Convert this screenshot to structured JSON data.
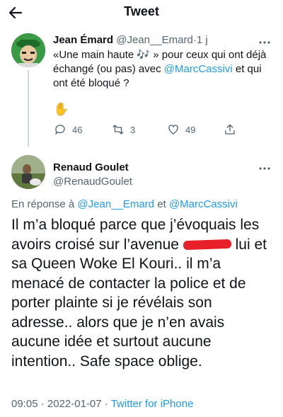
{
  "header": {
    "title": "Tweet"
  },
  "parent_tweet": {
    "display_name": "Jean Émard",
    "handle": "@Jean__Emard",
    "sep": "·",
    "time": "1 j",
    "text_1": "«Une main haute ",
    "emoji_notes": "🎶",
    "text_2": " » pour ceux qui ont déjà échangé (ou pas) avec ",
    "mention": "@MarcCassivi",
    "text_3": " et qui ont été bloqué ?",
    "emoji_hand": "✋",
    "replies": "46",
    "retweets": "3",
    "likes": "49"
  },
  "reply_tweet": {
    "display_name": "Renaud Goulet",
    "handle": "@RenaudGoulet",
    "reply_prefix": "En réponse à ",
    "reply_to_1": "@Jean__Emard",
    "reply_and": " et ",
    "reply_to_2": "@MarcCassivi",
    "body_1": "Il m’a bloqué parce que j’évoquais les avoirs croisé sur l’avenue ",
    "body_2": " lui et sa Queen Woke El Kouri.. il m’a menacé de contacter la police et de porter plainte si je révélais son adresse.. alors que je n’en avais aucune idée et surtout aucune intention.. Safe space oblige.",
    "time": "09:05",
    "date": "2022-01-07",
    "source": "Twitter for iPhone",
    "sep": "·"
  }
}
